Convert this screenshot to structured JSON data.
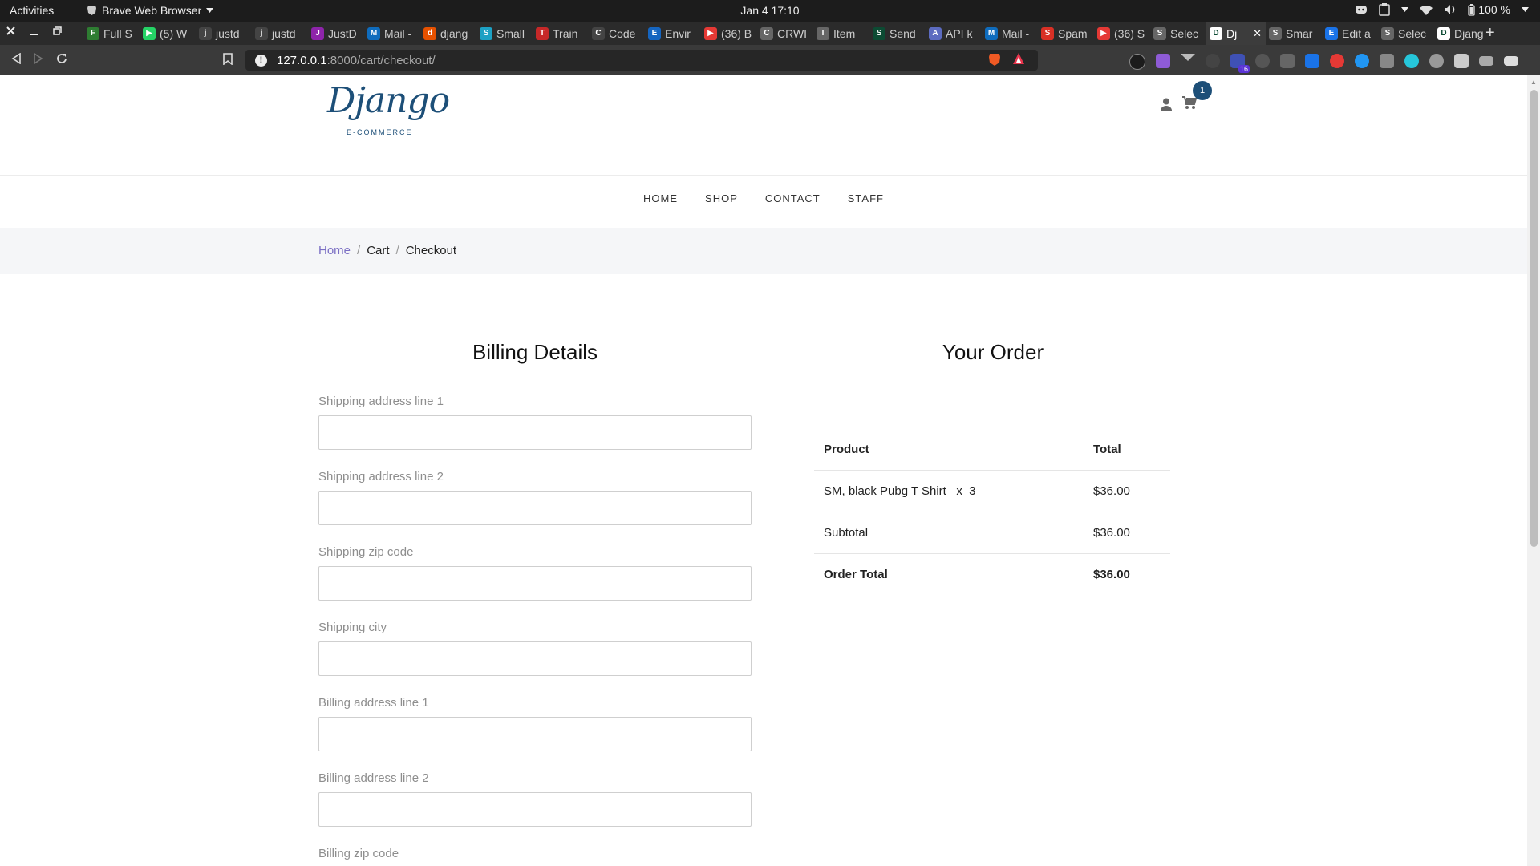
{
  "system": {
    "activities": "Activities",
    "app_name": "Brave Web Browser",
    "clock": "Jan 4  17:10",
    "battery": "100 %"
  },
  "browser": {
    "tabs": [
      {
        "title": "Full S",
        "color": "#2e7d32",
        "icon": "code-icon"
      },
      {
        "title": "(5) W",
        "color": "#25d366",
        "icon": "whatsapp-icon"
      },
      {
        "title": "justd",
        "color": "#444",
        "icon": "github-icon"
      },
      {
        "title": "justd",
        "color": "#444",
        "icon": "github-icon"
      },
      {
        "title": "JustD",
        "color": "#8e24aa",
        "icon": "justd-icon"
      },
      {
        "title": "Mail -",
        "color": "#0f6cbd",
        "icon": "outlook-icon"
      },
      {
        "title": "djang",
        "color": "#e65100",
        "icon": "django-icon"
      },
      {
        "title": "Small",
        "color": "#1da1c4",
        "icon": "s-icon"
      },
      {
        "title": "Train",
        "color": "#c62828",
        "icon": "train-icon"
      },
      {
        "title": "Code",
        "color": "#444",
        "icon": "github-icon"
      },
      {
        "title": "Envir",
        "color": "#1565c0",
        "icon": "env-icon"
      },
      {
        "title": "(36) B",
        "color": "#e53935",
        "icon": "youtube-icon"
      },
      {
        "title": "CRWI",
        "color": "#666",
        "icon": "crown-icon"
      },
      {
        "title": "Item",
        "color": "#666",
        "icon": "globe-icon"
      },
      {
        "title": "Send",
        "color": "#0c4b33",
        "icon": "django-dj-icon"
      },
      {
        "title": "API k",
        "color": "#5c6bc0",
        "icon": "api-icon"
      },
      {
        "title": "Mail -",
        "color": "#0f6cbd",
        "icon": "outlook-icon"
      },
      {
        "title": "Spam",
        "color": "#d93025",
        "icon": "gmail-icon"
      },
      {
        "title": "(36) S",
        "color": "#e53935",
        "icon": "youtube-icon"
      },
      {
        "title": "Selec",
        "color": "#666",
        "icon": "globe-icon"
      },
      {
        "title": "Dj",
        "color": "#ffffff",
        "icon": "django-icon",
        "active": true
      },
      {
        "title": "Smar",
        "color": "#666",
        "icon": "globe-icon"
      },
      {
        "title": "Edit a",
        "color": "#1a73e8",
        "icon": "paypal-icon"
      },
      {
        "title": "Selec",
        "color": "#666",
        "icon": "globe-icon"
      },
      {
        "title": "Djang",
        "color": "#ffffff",
        "icon": "django-icon"
      }
    ],
    "url_host": "127.0.0.1",
    "url_path": ":8000/cart/checkout/",
    "extension_badge": "16"
  },
  "site": {
    "logo_script": "Django",
    "logo_sub": "E-COMMERCE",
    "cart_count": "1",
    "nav": [
      "HOME",
      "SHOP",
      "CONTACT",
      "STAFF"
    ],
    "breadcrumb": {
      "home": "Home",
      "cart": "Cart",
      "current": "Checkout"
    }
  },
  "billing": {
    "title": "Billing Details",
    "fields": [
      {
        "label": "Shipping address line 1",
        "value": ""
      },
      {
        "label": "Shipping address line 2",
        "value": ""
      },
      {
        "label": "Shipping zip code",
        "value": ""
      },
      {
        "label": "Shipping city",
        "value": ""
      },
      {
        "label": "Billing address line 1",
        "value": ""
      },
      {
        "label": "Billing address line 2",
        "value": ""
      },
      {
        "label": "Billing zip code",
        "value": ""
      }
    ]
  },
  "order": {
    "title": "Your Order",
    "headers": {
      "product": "Product",
      "total": "Total"
    },
    "items": [
      {
        "product": "SM, black Pubg T Shirt   x  3",
        "total": "$36.00"
      }
    ],
    "subtotal_label": "Subtotal",
    "subtotal": "$36.00",
    "total_label": "Order Total",
    "total": "$36.00"
  }
}
